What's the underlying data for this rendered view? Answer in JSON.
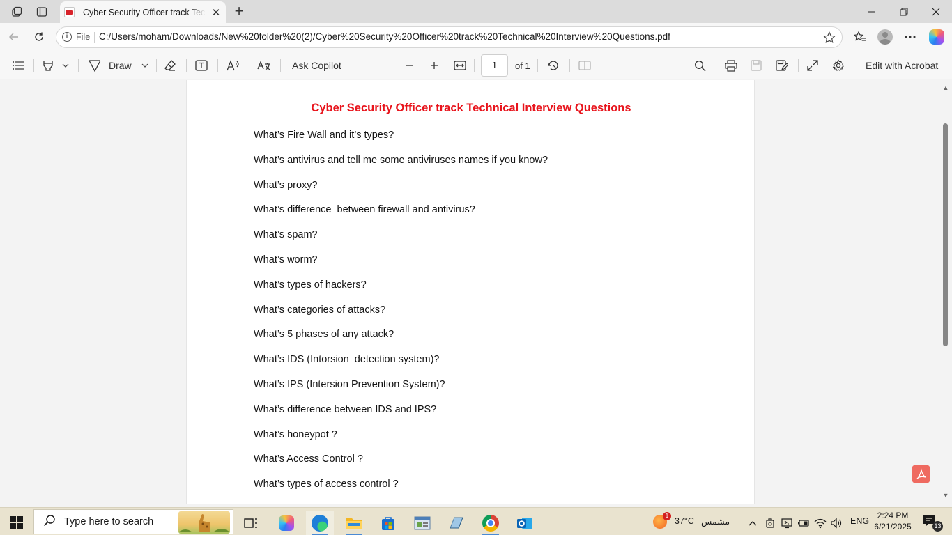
{
  "browser": {
    "tab": {
      "title": "Cyber Security Officer track Technical Interview Questions"
    },
    "address": {
      "scheme_label": "File",
      "url": "C:/Users/moham/Downloads/New%20folder%20(2)/Cyber%20Security%20Officer%20track%20Technical%20Interview%20Questions.pdf"
    }
  },
  "pdf_toolbar": {
    "draw_label": "Draw",
    "copilot_label": "Ask Copilot",
    "page_input": "1",
    "page_total": "of 1",
    "edit_label": "Edit with Acrobat"
  },
  "document": {
    "title": "Cyber Security Officer track Technical Interview Questions",
    "questions": [
      "What’s Fire Wall and it’s types?",
      "What’s antivirus and tell me some antiviruses names if you know?",
      "What’s proxy?",
      "What’s difference  between firewall and antivirus?",
      "What’s spam?",
      "What’s worm?",
      "What’s types of hackers?",
      "What’s categories of attacks?",
      "What’s 5 phases of any attack?",
      "What’s IDS (Intorsion  detection system)?",
      "What’s IPS (Intersion Prevention System)?",
      "What’s difference between IDS and IPS?",
      "What’s honeypot ?",
      "What’s Access Control ?",
      "What’s types of access control ?"
    ],
    "title_color": "#e8141c"
  },
  "taskbar": {
    "search_placeholder": "Type here to search",
    "weather": {
      "temp": "37°C",
      "condition": "مشمس",
      "alert_count": "1"
    },
    "language": "ENG",
    "time": "2:24 PM",
    "date": "6/21/2025",
    "notification_count": "13"
  },
  "icons": [
    "workspaces-icon",
    "tab-actions-icon",
    "pdf-icon",
    "close-icon",
    "plus-icon",
    "minimize-icon",
    "restore-icon",
    "back-icon",
    "refresh-icon",
    "info-icon",
    "star-icon",
    "favorites-icon",
    "profile-icon",
    "more-icon",
    "copilot-icon",
    "contents-icon",
    "highlight-icon",
    "draw-icon",
    "eraser-icon",
    "text-box-icon",
    "read-aloud-icon",
    "translate-icon",
    "zoom-out-icon",
    "zoom-in-icon",
    "fit-width-icon",
    "rotate-icon",
    "two-page-icon",
    "search-icon",
    "print-icon",
    "save-icon",
    "save-as-icon",
    "fullscreen-icon",
    "settings-icon",
    "acrobat-icon"
  ]
}
